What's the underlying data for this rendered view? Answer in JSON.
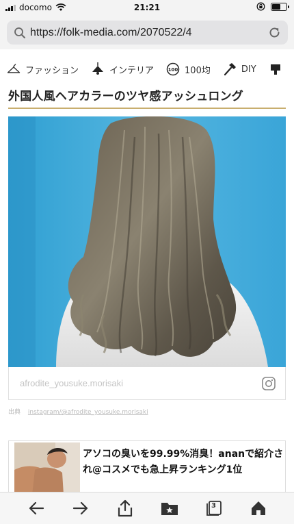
{
  "status_bar": {
    "carrier": "docomo",
    "time": "21:21",
    "battery_level": 0.62
  },
  "address_bar": {
    "url": "https://folk-media.com/2070522/4",
    "search_icon": "search-icon",
    "reload_icon": "reload-icon"
  },
  "categories": [
    {
      "label": "ファッション",
      "icon": "hanger-icon"
    },
    {
      "label": "インテリア",
      "icon": "lamp-icon"
    },
    {
      "label": "100均",
      "icon": "100-badge-icon"
    },
    {
      "label": "DIY",
      "icon": "hammer-icon"
    }
  ],
  "article": {
    "heading": "外国人風ヘアカラーのツヤ感アッシュロング",
    "photo_credit": "afrodite_yousuke.morisaki",
    "source_label": "出典",
    "source_link": "instagram/@afrodite_yousuke.morisaki"
  },
  "ad": {
    "text": "アソコの臭いを99.99%消臭！ananで紹介され@コスメでも急上昇ランキング1位"
  },
  "toolbar": {
    "tab_count": "3"
  },
  "colors": {
    "accent_rule": "#c8ae6e",
    "photo_background": "#3fa8d6",
    "chrome_bg": "#f3f3f3"
  }
}
